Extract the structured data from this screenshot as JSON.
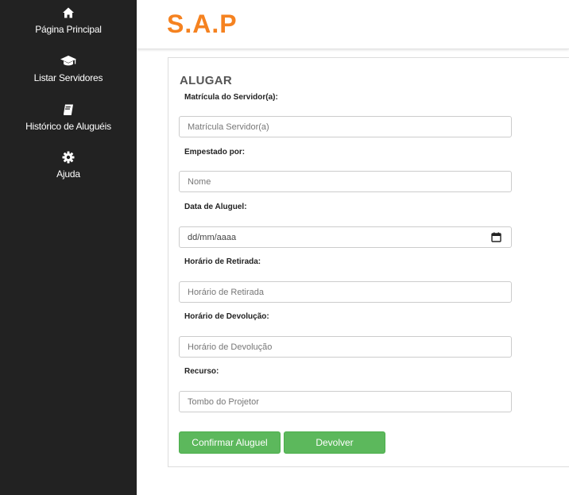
{
  "sidebar": {
    "items": [
      {
        "icon": "home-icon",
        "label": "Página Principal"
      },
      {
        "icon": "graduation-cap-icon",
        "label": "Listar Servidores"
      },
      {
        "icon": "book-icon",
        "label": "Histórico de Aluguéis"
      },
      {
        "icon": "gear-icon",
        "label": "Ajuda"
      }
    ]
  },
  "header": {
    "brand": "S.A.P",
    "brand_color": "#f58220"
  },
  "form": {
    "title": "ALUGAR",
    "matricula": {
      "label": "Matrícula do Servidor(a):",
      "placeholder": "Matrícula Servidor(a)"
    },
    "emprestado": {
      "label": "Empestado por:",
      "placeholder": "Nome"
    },
    "data": {
      "label": "Data de Aluguel:",
      "placeholder": "dd/mm/aaaa"
    },
    "retirada": {
      "label": "Horário de Retirada:",
      "placeholder": "Horário de Retirada"
    },
    "devolucao": {
      "label": "Horário de Devolução:",
      "placeholder": "Horário de Devolução"
    },
    "recurso": {
      "label": "Recurso:",
      "placeholder": "Tombo do Projetor"
    },
    "confirm_label": "Confirmar Aluguel",
    "return_label": "Devolver",
    "button_color": "#5cb85c"
  }
}
